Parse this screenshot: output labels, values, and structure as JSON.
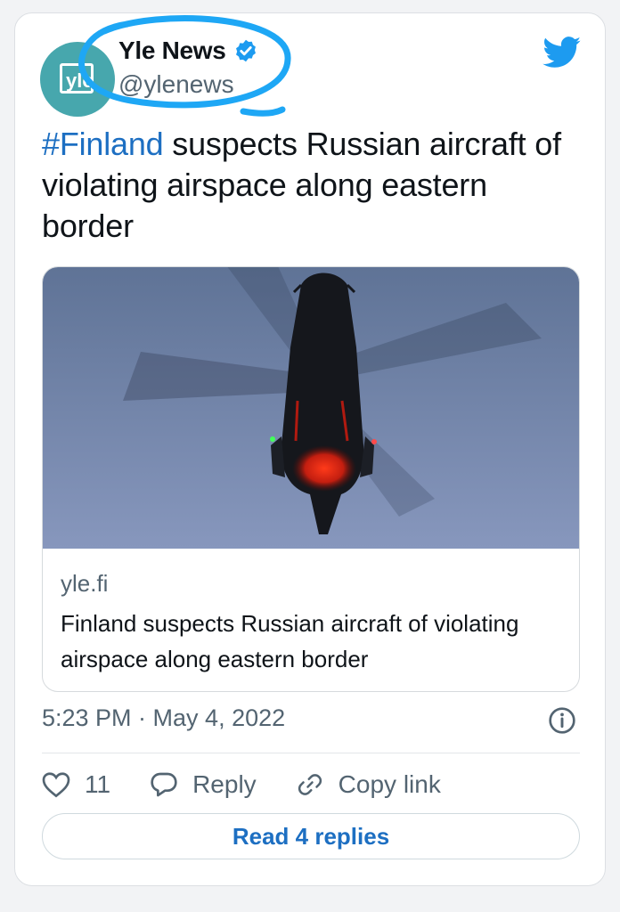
{
  "tweet": {
    "display_name": "Yle News",
    "handle": "@ylenews",
    "avatar_text": "yle",
    "text_hashtag": "#Finland",
    "text_rest": " suspects Russian aircraft of violating airspace along eastern border",
    "timestamp": "5:23 PM · May 4, 2022"
  },
  "link_card": {
    "domain": "yle.fi",
    "title": "Finland suspects Russian aircraft of violating airspace along eastern border"
  },
  "actions": {
    "like_count": "11",
    "reply_label": "Reply",
    "copy_link_label": "Copy link"
  },
  "read_replies_label": "Read 4 replies",
  "colors": {
    "accent": "#1d9bf0",
    "link_blue": "#1d6fc2",
    "annotation": "#1ea7f5",
    "avatar_bg": "#47a7ad"
  },
  "icons": [
    "verified-badge-icon",
    "twitter-bird-icon",
    "info-icon",
    "heart-icon",
    "reply-bubble-icon",
    "link-icon"
  ]
}
